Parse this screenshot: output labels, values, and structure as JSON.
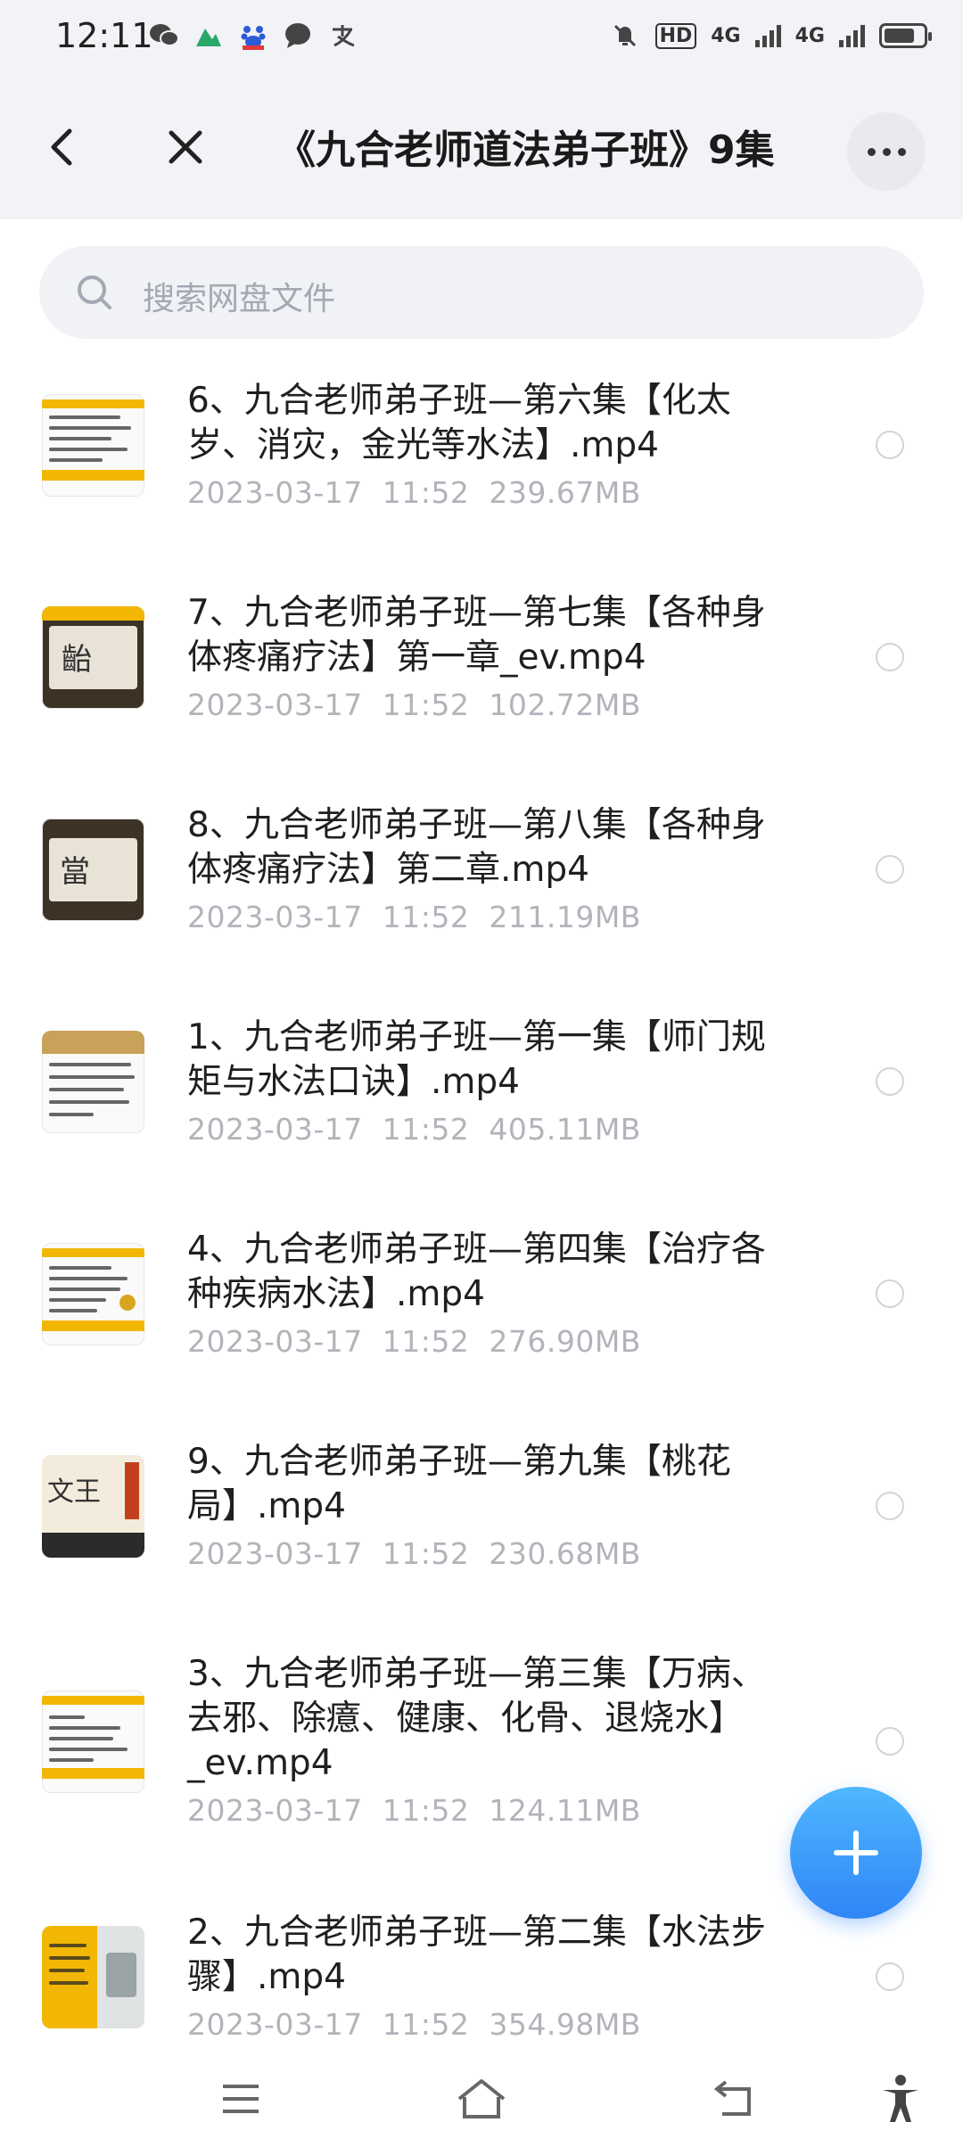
{
  "status_bar": {
    "time": "12:11",
    "left_icons": [
      "wechat-icon",
      "maps-icon",
      "baidu-icon",
      "chat-bubble-icon",
      "alipay-icon"
    ],
    "hd_label": "HD",
    "network_1": "4G",
    "network_2": "4G"
  },
  "header": {
    "title": "《九合老师道法弟子班》9集",
    "back_icon": "back-arrow-icon",
    "close_icon": "close-icon",
    "more_icon": "more-dots-icon"
  },
  "search": {
    "placeholder": "搜索网盘文件",
    "icon": "search-icon"
  },
  "files": [
    {
      "name_line1": "6、九合老师弟子班—第六集【化太",
      "name_line2": "岁、消灾，金光等水法】.mp4",
      "name_line3": "",
      "date": "2023-03-17",
      "time": "11:52",
      "size": "239.67MB"
    },
    {
      "name_line1": "7、九合老师弟子班—第七集【各种身",
      "name_line2": "体疼痛疗法】第一章_ev.mp4",
      "name_line3": "",
      "date": "2023-03-17",
      "time": "11:52",
      "size": "102.72MB"
    },
    {
      "name_line1": "8、九合老师弟子班—第八集【各种身",
      "name_line2": "体疼痛疗法】第二章.mp4",
      "name_line3": "",
      "date": "2023-03-17",
      "time": "11:52",
      "size": "211.19MB"
    },
    {
      "name_line1": "1、九合老师弟子班—第一集【师门规",
      "name_line2": "矩与水法口诀】.mp4",
      "name_line3": "",
      "date": "2023-03-17",
      "time": "11:52",
      "size": "405.11MB"
    },
    {
      "name_line1": "4、九合老师弟子班—第四集【治疗各",
      "name_line2": "种疾病水法】.mp4",
      "name_line3": "",
      "date": "2023-03-17",
      "time": "11:52",
      "size": "276.90MB"
    },
    {
      "name_line1": "9、九合老师弟子班—第九集【桃花",
      "name_line2": "局】.mp4",
      "name_line3": "",
      "date": "2023-03-17",
      "time": "11:52",
      "size": "230.68MB"
    },
    {
      "name_line1": "3、九合老师弟子班—第三集【万病、",
      "name_line2": "去邪、除癔、健康、化骨、退烧水】",
      "name_line3": "_ev.mp4",
      "date": "2023-03-17",
      "time": "11:52",
      "size": "124.11MB"
    },
    {
      "name_line1": "2、九合老师弟子班—第二集【水法步",
      "name_line2": "骤】.mp4",
      "name_line3": "",
      "date": "2023-03-17",
      "time": "11:52",
      "size": "354.98MB"
    }
  ],
  "thumb_glyphs": {
    "file2": "齝",
    "file3": "當",
    "file6": "文王"
  },
  "fab_icon": "plus-icon",
  "nav": {
    "menu_icon": "menu-icon",
    "home_icon": "home-icon",
    "back_icon": "nav-back-icon",
    "accessibility_icon": "accessibility-icon"
  },
  "colors": {
    "accent": "#2f86f6",
    "thumb_yellow": "#f2b705",
    "meta_gray": "#b2b4bb",
    "header_bg": "#f2f3f7"
  }
}
